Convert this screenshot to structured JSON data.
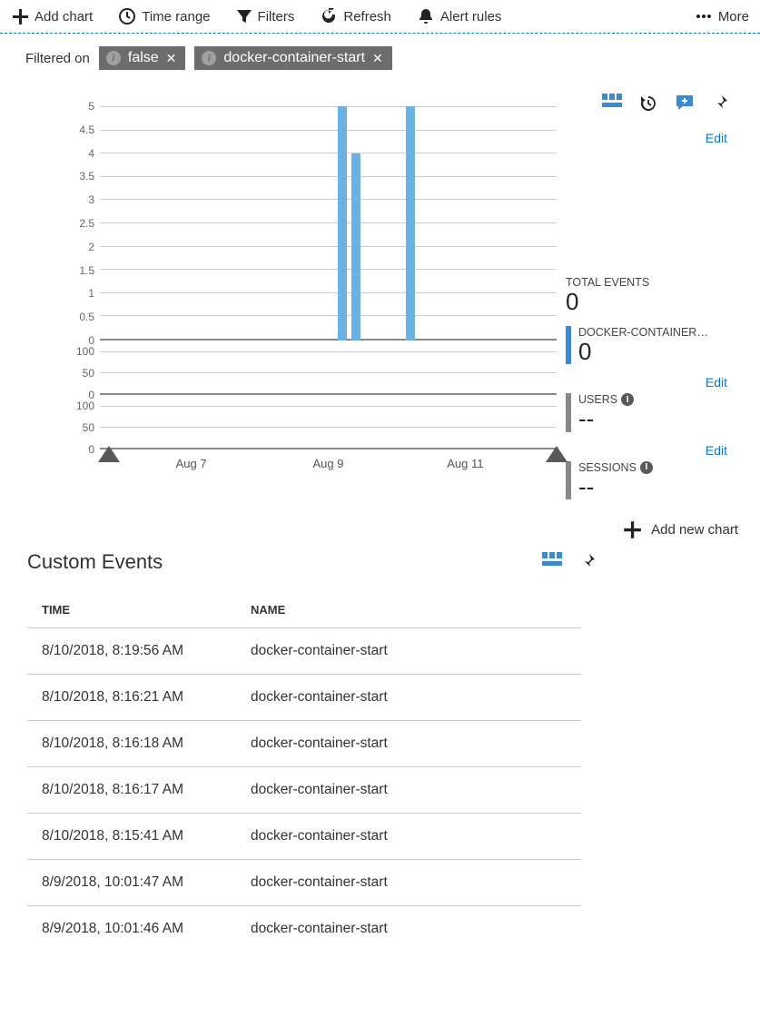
{
  "toolbar": {
    "add_chart": "Add chart",
    "time_range": "Time range",
    "filters": "Filters",
    "refresh": "Refresh",
    "alert_rules": "Alert rules",
    "more": "More"
  },
  "filter_bar": {
    "label": "Filtered on",
    "chips": [
      "false",
      "docker-container-start"
    ]
  },
  "edit_label": "Edit",
  "metrics": {
    "total_events": {
      "label": "TOTAL EVENTS",
      "value": "0"
    },
    "docker": {
      "label": "DOCKER-CONTAINER…",
      "value": "0",
      "color": "#3b8bd4"
    },
    "users": {
      "label": "USERS",
      "value": "--",
      "color": "#888"
    },
    "sessions": {
      "label": "SESSIONS",
      "value": "--",
      "color": "#888"
    }
  },
  "add_new_chart": "Add new chart",
  "chart_data": [
    {
      "type": "bar",
      "title": "",
      "x_ticks": [
        "Aug 7",
        "Aug 9",
        "Aug 11"
      ],
      "y_ticks": [
        0,
        0.5,
        1,
        1.5,
        2,
        2.5,
        3,
        3.5,
        4,
        4.5,
        5
      ],
      "ylim": [
        0,
        5
      ],
      "series": [
        {
          "name": "docker-container-start",
          "color": "#6ab1e4",
          "points": [
            {
              "x": "Aug 9 04:00",
              "value": 5
            },
            {
              "x": "Aug 9 08:00",
              "value": 4
            },
            {
              "x": "Aug 10 08:00",
              "value": 5
            }
          ]
        }
      ]
    },
    {
      "type": "bar",
      "title": "Users",
      "y_ticks": [
        0,
        50,
        100
      ],
      "ylim": [
        0,
        100
      ],
      "series": []
    },
    {
      "type": "bar",
      "title": "Sessions",
      "y_ticks": [
        0,
        50,
        100
      ],
      "ylim": [
        0,
        100
      ],
      "series": []
    }
  ],
  "events": {
    "title": "Custom Events",
    "columns": {
      "time": "TIME",
      "name": "NAME"
    },
    "rows": [
      {
        "time": "8/10/2018, 8:19:56 AM",
        "name": "docker-container-start"
      },
      {
        "time": "8/10/2018, 8:16:21 AM",
        "name": "docker-container-start"
      },
      {
        "time": "8/10/2018, 8:16:18 AM",
        "name": "docker-container-start"
      },
      {
        "time": "8/10/2018, 8:16:17 AM",
        "name": "docker-container-start"
      },
      {
        "time": "8/10/2018, 8:15:41 AM",
        "name": "docker-container-start"
      },
      {
        "time": "8/9/2018, 10:01:47 AM",
        "name": "docker-container-start"
      },
      {
        "time": "8/9/2018, 10:01:46 AM",
        "name": "docker-container-start"
      }
    ]
  }
}
